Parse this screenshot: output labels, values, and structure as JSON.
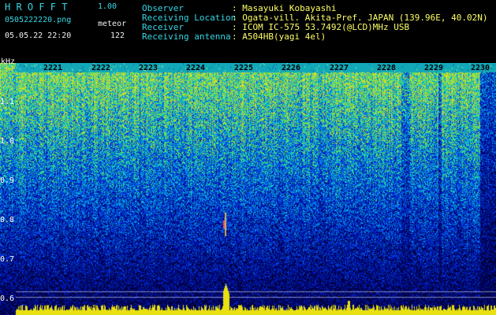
{
  "app": {
    "name": "H R O F F T",
    "version": "1.00",
    "filename": "0505222220.png",
    "detector": "meteor",
    "date_time": "05.05.22 22:20",
    "count": "122"
  },
  "info": {
    "rows": [
      {
        "label": "Observer",
        "value": ": Masayuki Kobayashi"
      },
      {
        "label": "Receiving Location",
        "value": ": Ogata-vill. Akita-Pref. JAPAN (139.96E, 40.02N)"
      },
      {
        "label": "Receiver",
        "value": ": ICOM IC-575 53.7492(@LCD)MHz USB"
      },
      {
        "label": "Receiving antenna",
        "value": ": A504HB(yagi 4el)"
      }
    ]
  },
  "spectrogram": {
    "unit": "kHz",
    "freq_ticks": [
      "1.1",
      "1.0",
      "0.9",
      "0.8",
      "0.7",
      "0.6"
    ],
    "time_ticks": [
      "2221",
      "2222",
      "2223",
      "2224",
      "2225",
      "2226",
      "2227",
      "2228",
      "2229",
      "2230"
    ]
  },
  "colors": {
    "background": "#000000",
    "header_label": "#35d7e6",
    "header_value": "#ffff66",
    "detection": "#ff4466"
  }
}
